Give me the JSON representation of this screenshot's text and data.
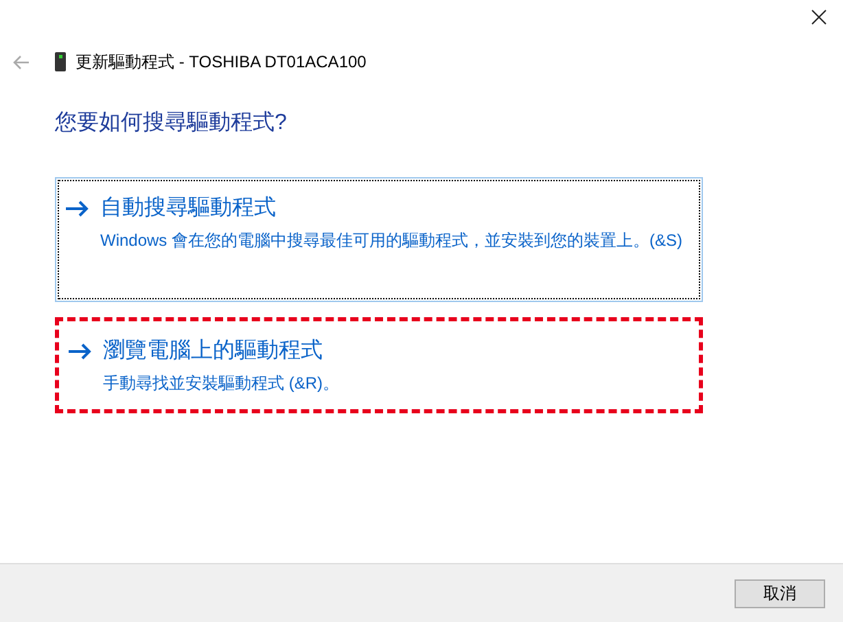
{
  "window": {
    "title": "更新驅動程式 - TOSHIBA DT01ACA100"
  },
  "heading": "您要如何搜尋驅動程式?",
  "options": [
    {
      "title": "自動搜尋驅動程式",
      "description": "Windows 會在您的電腦中搜尋最佳可用的驅動程式，並安裝到您的裝置上。(&S)",
      "focused": true,
      "highlighted": false
    },
    {
      "title": "瀏覽電腦上的驅動程式",
      "description": "手動尋找並安裝驅動程式 (&R)。",
      "focused": false,
      "highlighted": true
    }
  ],
  "buttons": [
    "取消"
  ]
}
